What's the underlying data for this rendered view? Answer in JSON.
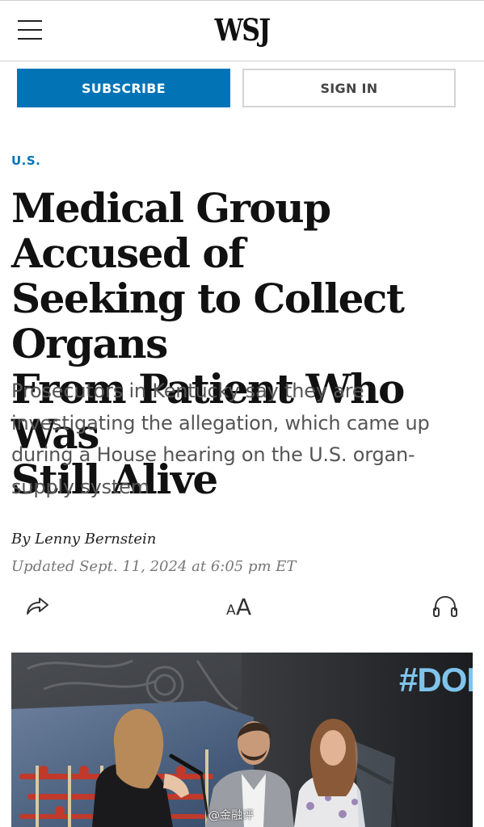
{
  "header": {
    "logo": "WSJ",
    "menu_icon": "hamburger-menu-icon"
  },
  "buttons": {
    "subscribe": "SUBSCRIBE",
    "sign_in": "SIGN IN"
  },
  "article": {
    "section": "U.S.",
    "headline_lines": [
      "Medical Group Accused of",
      "Seeking to Collect Organs",
      "From Patient Who Was",
      "Still Alive"
    ],
    "dek_lines": [
      "Prosecutors in Kentucky say they are",
      "investigating the allegation, which came up",
      "during a House hearing on the U.S. organ-",
      "supply system"
    ],
    "byline": "By Lenny Bernstein",
    "updated": "Updated Sept. 11, 2024 at 6:05 pm ET"
  },
  "toolbar": {
    "share_icon": "share-icon",
    "text_size_small": "A",
    "text_size_large": "A",
    "audio_icon": "headphones-icon"
  },
  "photo": {
    "screen_text": "#DON",
    "watermark": "@金融评"
  },
  "colors": {
    "accent": "#0274b6",
    "text": "#111111",
    "dek": "#555555",
    "muted": "#777777"
  }
}
